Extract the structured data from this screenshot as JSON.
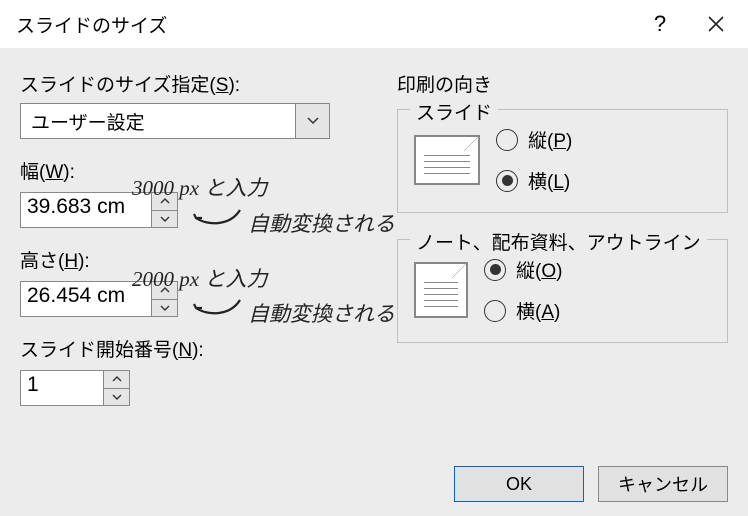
{
  "title": "スライドのサイズ",
  "labels": {
    "sizeSpec": "スライドのサイズ指定(",
    "sizeSpecKey": "S",
    "sizeSpecEnd": "):",
    "width": "幅(",
    "widthKey": "W",
    "widthEnd": "):",
    "height": "高さ(",
    "heightKey": "H",
    "heightEnd": "):",
    "startNum": "スライド開始番号(",
    "startNumKey": "N",
    "startNumEnd": "):"
  },
  "combo": {
    "selected": "ユーザー設定"
  },
  "values": {
    "width": "39.683 cm",
    "height": "26.454 cm",
    "startNum": "1"
  },
  "right": {
    "header": "印刷の向き",
    "group1": {
      "title": "スライド",
      "options": {
        "portrait": {
          "label": "縦(",
          "key": "P",
          "end": ")",
          "checked": false
        },
        "landscape": {
          "label": "横(",
          "key": "L",
          "end": ")",
          "checked": true
        }
      }
    },
    "group2": {
      "title": "ノート、配布資料、アウトライン",
      "options": {
        "portrait": {
          "label": "縦(",
          "key": "O",
          "end": ")",
          "checked": true
        },
        "landscape": {
          "label": "横(",
          "key": "A",
          "end": ")",
          "checked": false
        }
      }
    }
  },
  "buttons": {
    "ok": "OK",
    "cancel": "キャンセル"
  },
  "annotations": {
    "widthHand": "3000 px と入力",
    "widthAuto": "自動変換される",
    "heightHand": "2000 px と入力",
    "heightAuto": "自動変換される"
  }
}
